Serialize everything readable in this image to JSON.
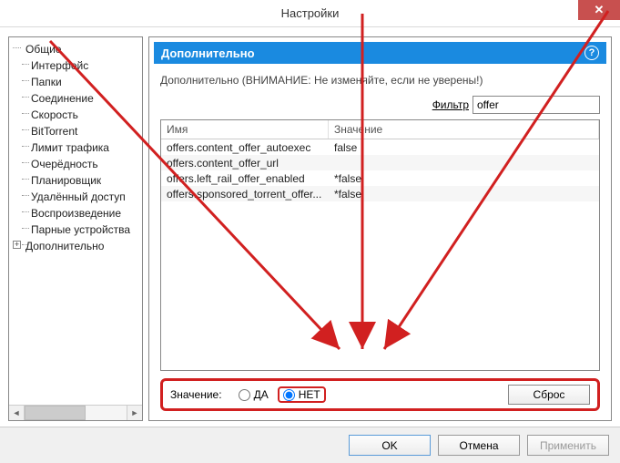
{
  "window": {
    "title": "Настройки",
    "close": "✕"
  },
  "sidebar": {
    "items": [
      {
        "label": "Общие",
        "type": "root"
      },
      {
        "label": "Интерфейс",
        "type": "child"
      },
      {
        "label": "Папки",
        "type": "child"
      },
      {
        "label": "Соединение",
        "type": "child"
      },
      {
        "label": "Скорость",
        "type": "child"
      },
      {
        "label": "BitTorrent",
        "type": "child"
      },
      {
        "label": "Лимит трафика",
        "type": "child"
      },
      {
        "label": "Очерёдность",
        "type": "child"
      },
      {
        "label": "Планировщик",
        "type": "child"
      },
      {
        "label": "Удалённый доступ",
        "type": "child"
      },
      {
        "label": "Воспроизведение",
        "type": "child"
      },
      {
        "label": "Парные устройства",
        "type": "child"
      },
      {
        "label": "Дополнительно",
        "type": "expandable",
        "selected": true
      }
    ]
  },
  "main": {
    "header": "Дополнительно",
    "help": "?",
    "warning": "Дополнительно (ВНИМАНИЕ: Не изменяйте, если не уверены!)",
    "filter_label": "Фильтр",
    "filter_value": "offer",
    "columns": {
      "name": "Имя",
      "value": "Значение"
    },
    "rows": [
      {
        "name": "offers.content_offer_autoexec",
        "value": "false"
      },
      {
        "name": "offers.content_offer_url",
        "value": ""
      },
      {
        "name": "offers.left_rail_offer_enabled",
        "value": "*false"
      },
      {
        "name": "offers.sponsored_torrent_offer...",
        "value": "*false"
      }
    ],
    "value_label": "Значение:",
    "radio_yes": "ДА",
    "radio_no": "НЕТ",
    "reset": "Сброс"
  },
  "footer": {
    "ok": "OK",
    "cancel": "Отмена",
    "apply": "Применить"
  }
}
